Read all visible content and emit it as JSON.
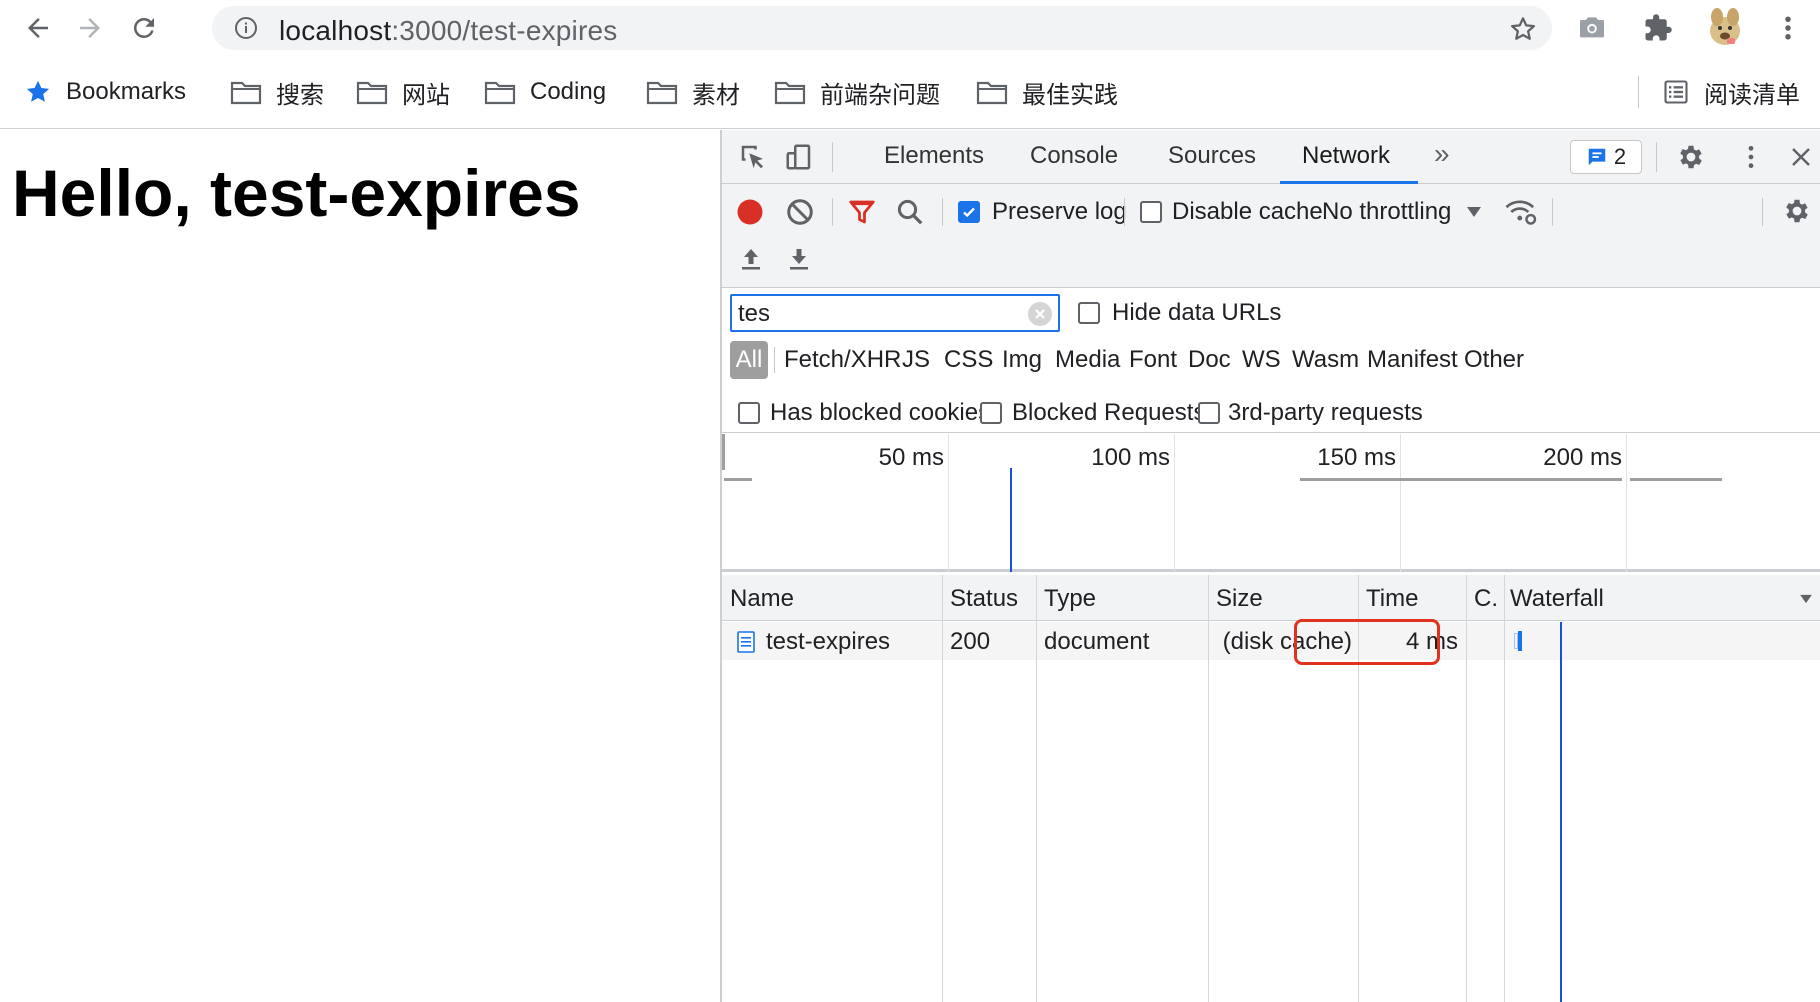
{
  "browser": {
    "url_host": "localhost",
    "url_path": ":3000/test-expires",
    "nav_icons": [
      "back-icon",
      "forward-icon",
      "reload-icon"
    ],
    "toolbar_icons": [
      "camera-icon",
      "extensions-icon",
      "profile-avatar",
      "menu-icon"
    ]
  },
  "bookmarks": {
    "items": [
      {
        "label": "Bookmarks",
        "icon": "star-icon"
      },
      {
        "label": "搜索",
        "icon": "folder-icon"
      },
      {
        "label": "网站",
        "icon": "folder-icon"
      },
      {
        "label": "Coding",
        "icon": "folder-icon"
      },
      {
        "label": "素材",
        "icon": "folder-icon"
      },
      {
        "label": "前端杂问题",
        "icon": "folder-icon"
      },
      {
        "label": "最佳实践",
        "icon": "folder-icon"
      }
    ],
    "reading_list": "阅读清单"
  },
  "page": {
    "heading": "Hello, test-expires"
  },
  "devtools": {
    "tabs": [
      "Elements",
      "Console",
      "Sources",
      "Network"
    ],
    "active_tab": "Network",
    "more_tabs": "»",
    "issues_count": "2",
    "controls": {
      "preserve_log_label": "Preserve log",
      "preserve_log_checked": true,
      "disable_cache_label": "Disable cache",
      "disable_cache_checked": false,
      "throttling": "No throttling"
    },
    "filter": {
      "value": "tes",
      "hide_data_urls_label": "Hide data URLs",
      "types": [
        "All",
        "Fetch/XHR",
        "JS",
        "CSS",
        "Img",
        "Media",
        "Font",
        "Doc",
        "WS",
        "Wasm",
        "Manifest",
        "Other"
      ],
      "active_type": "All",
      "has_blocked_cookies_label": "Has blocked cookies",
      "blocked_requests_label": "Blocked Requests",
      "third_party_label": "3rd-party requests"
    },
    "overview": {
      "ticks": [
        "50 ms",
        "100 ms",
        "150 ms",
        "200 ms"
      ]
    },
    "table": {
      "columns": [
        "Name",
        "Status",
        "Type",
        "Size",
        "Time",
        "C.",
        "Waterfall"
      ],
      "rows": [
        {
          "name": "test-expires",
          "status": "200",
          "type": "document",
          "size": "(disk cache)",
          "time": "4 ms",
          "c": ""
        }
      ]
    },
    "colors": {
      "accent": "#1a73e8",
      "record": "#d93025",
      "highlight": "#e0331f"
    }
  }
}
